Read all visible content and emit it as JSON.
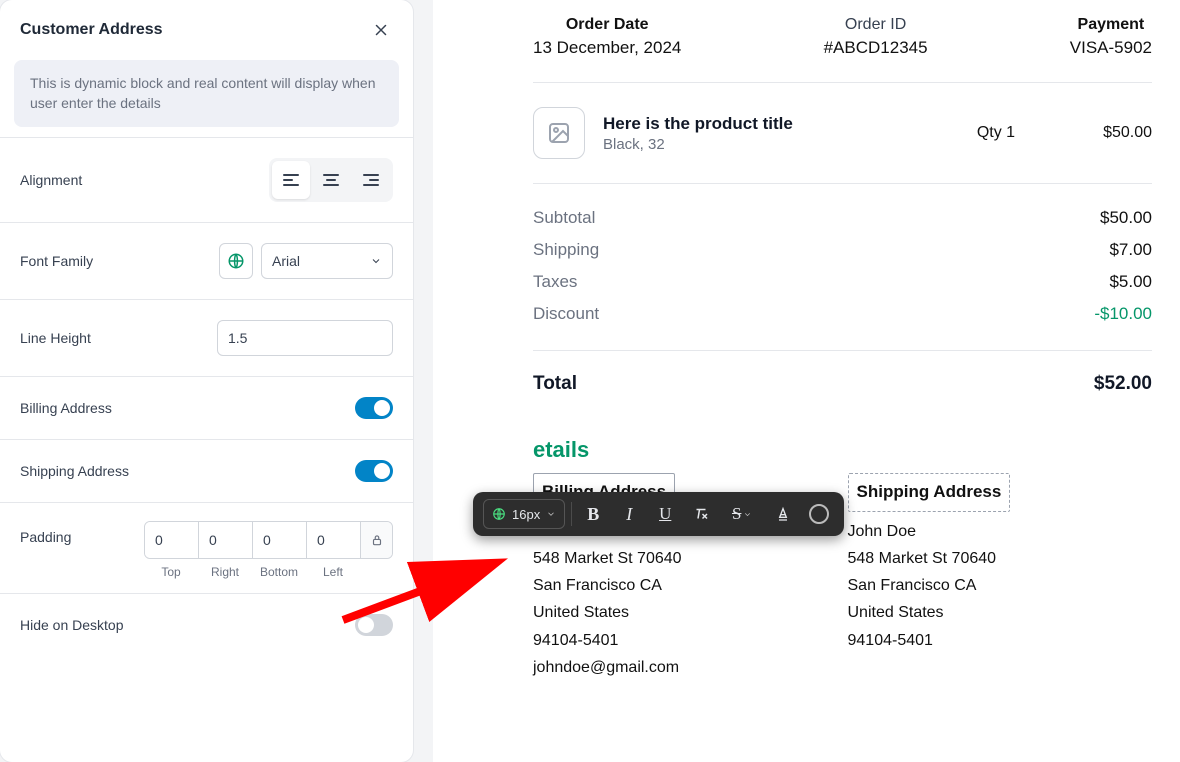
{
  "panel": {
    "title": "Customer Address",
    "info": "This is dynamic block and real content will display when user enter the details",
    "alignment_label": "Alignment",
    "font_family_label": "Font Family",
    "font_family_value": "Arial",
    "line_height_label": "Line Height",
    "line_height_value": "1.5",
    "billing_label": "Billing Address",
    "shipping_label": "Shipping Address",
    "padding_label": "Padding",
    "padding": {
      "top": "0",
      "right": "0",
      "bottom": "0",
      "left": "0"
    },
    "pad_labels": {
      "top": "Top",
      "right": "Right",
      "bottom": "Bottom",
      "left": "Left"
    },
    "hide_desktop_label": "Hide on Desktop"
  },
  "toolbar": {
    "font_size": "16px"
  },
  "order": {
    "date_label": "Order Date",
    "date_value": "13 December, 2024",
    "id_label": "Order ID",
    "id_value": "#ABCD12345",
    "payment_label": "Payment",
    "payment_value": "VISA-5902"
  },
  "item": {
    "title": "Here is the product title",
    "subtitle": "Black, 32",
    "qty": "Qty 1",
    "price": "$50.00"
  },
  "summary": {
    "subtotal_label": "Subtotal",
    "subtotal_value": "$50.00",
    "shipping_label": "Shipping",
    "shipping_value": "$7.00",
    "taxes_label": "Taxes",
    "taxes_value": "$5.00",
    "discount_label": "Discount",
    "discount_value": "-$10.00",
    "total_label": "Total",
    "total_value": "$52.00"
  },
  "details": {
    "heading_suffix": "etails",
    "billing_head": "Billing Address",
    "shipping_head": "Shipping Address",
    "name": "John Doe",
    "street": "548 Market St 70640",
    "city": "San Francisco CA",
    "country": "United States",
    "zip": "94104-5401",
    "email": "johndoe@gmail.com"
  }
}
